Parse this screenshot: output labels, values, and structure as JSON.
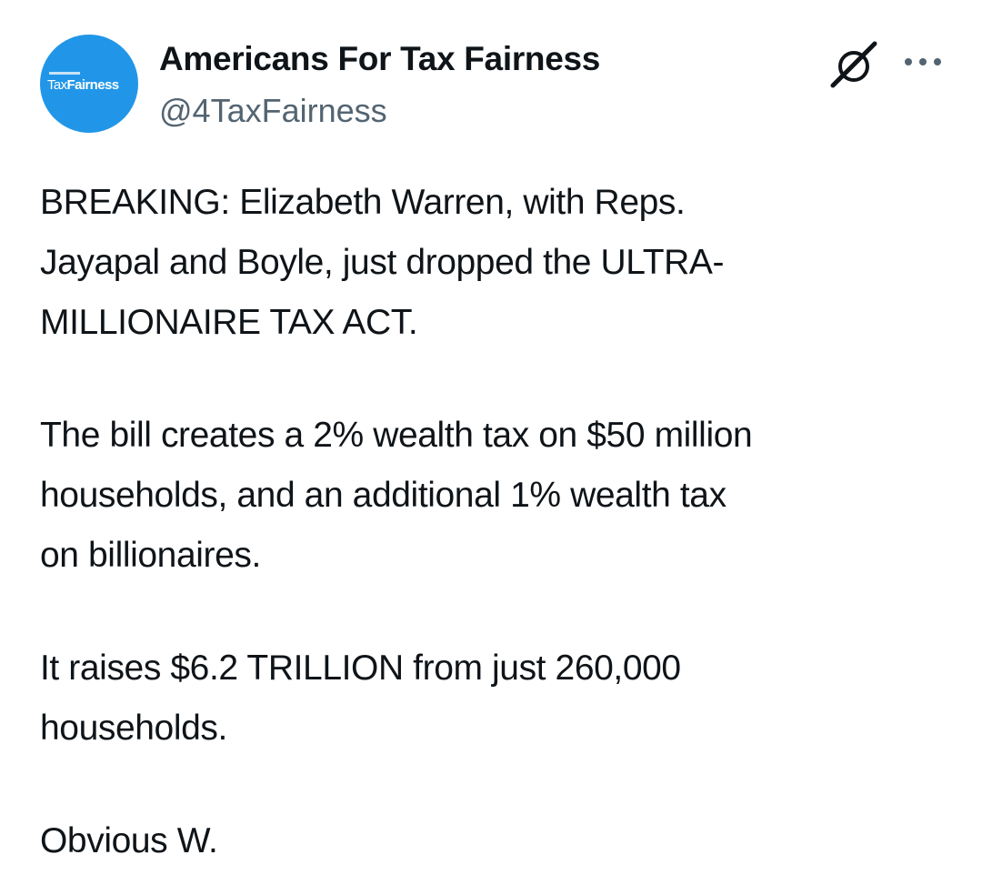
{
  "tweet": {
    "author": {
      "display_name": "Americans For Tax Fairness",
      "handle": "@4TaxFairness",
      "avatar": {
        "logo_text_light": "Tax",
        "logo_text_bold": "Fairness",
        "background_color": "#2196e8"
      }
    },
    "actions": {
      "grok_icon": "grok-icon",
      "more_icon": "more-horizontal-icon"
    },
    "paragraphs": [
      {
        "lines": [
          "BREAKING: Elizabeth Warren, with Reps.",
          "Jayapal and Boyle, just dropped the ULTRA-",
          "MILLIONAIRE TAX ACT."
        ]
      },
      {
        "lines": [
          "The bill creates a 2% wealth tax on $50 million",
          "households, and an additional 1% wealth tax",
          "on billionaires."
        ]
      },
      {
        "lines": [
          "It raises $6.2 TRILLION from just 260,000",
          "households."
        ]
      },
      {
        "lines": [
          "Obvious W."
        ]
      }
    ]
  }
}
